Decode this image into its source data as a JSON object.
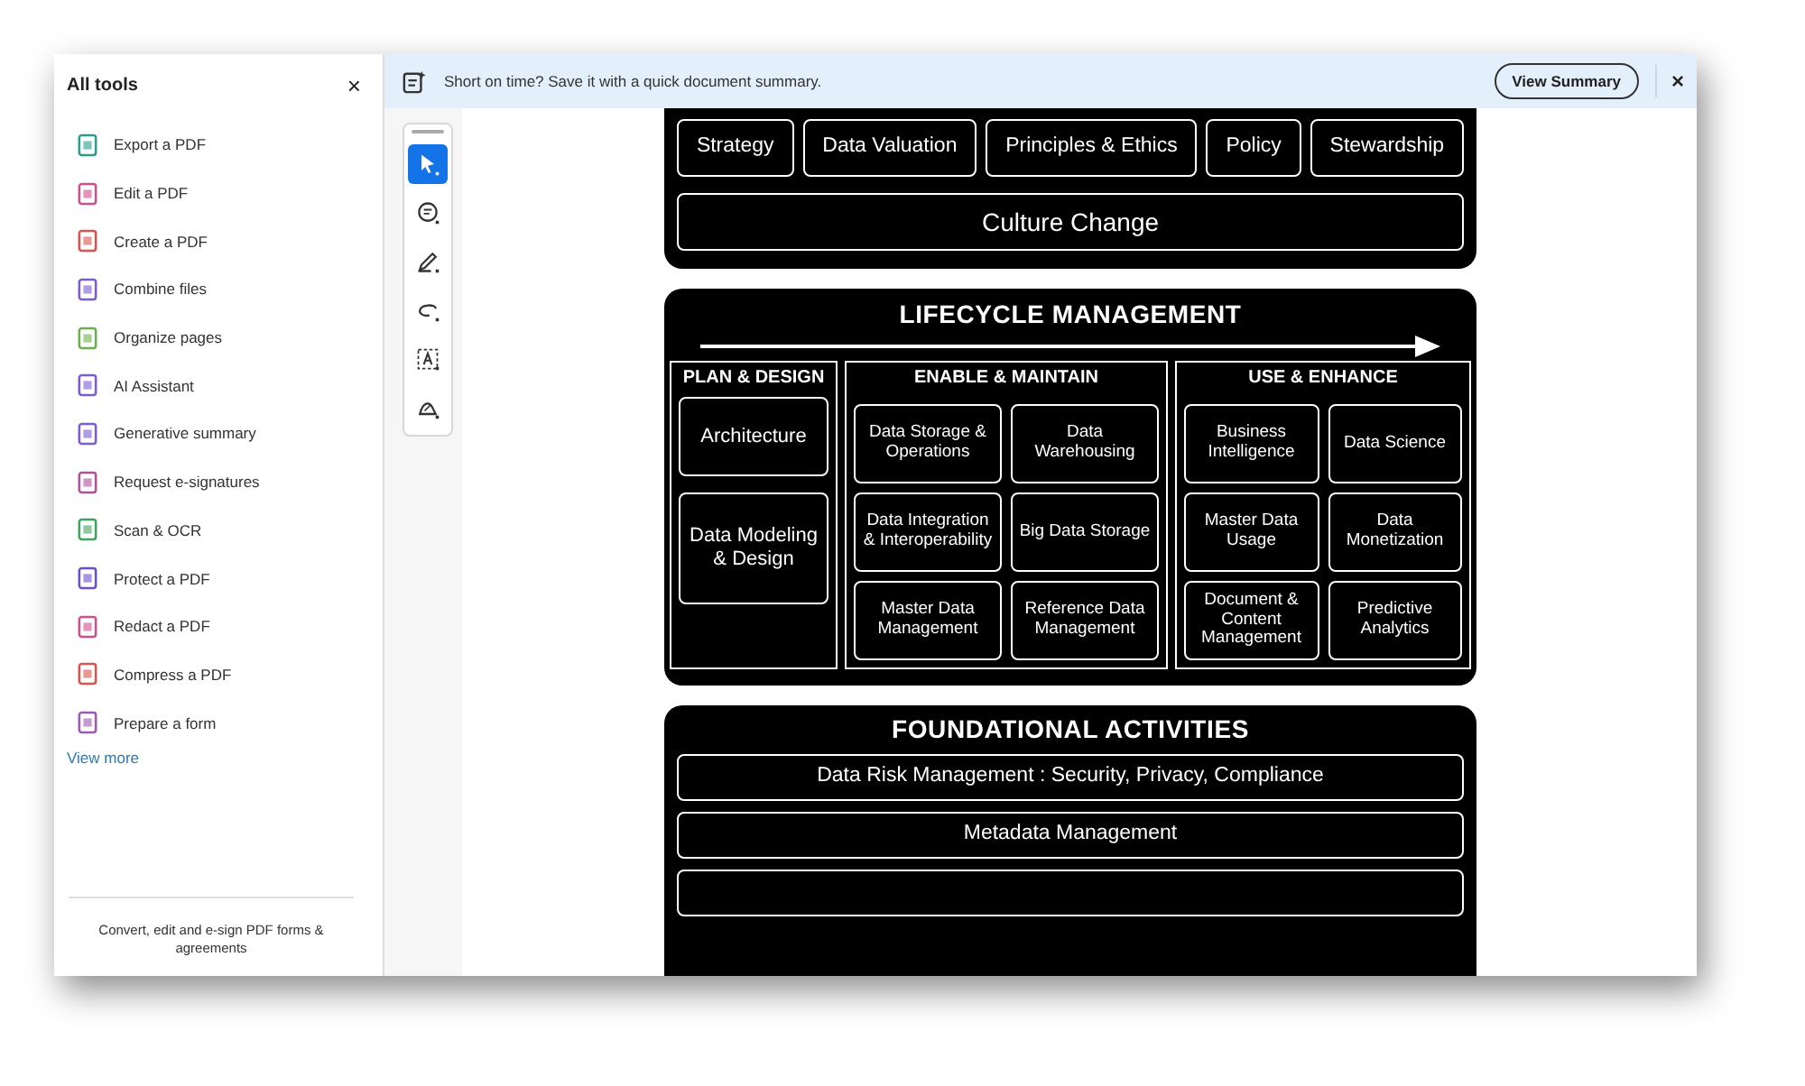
{
  "sidebar": {
    "title": "All tools",
    "close": "×",
    "items": [
      {
        "label": "Export a PDF"
      },
      {
        "label": "Edit a PDF"
      },
      {
        "label": "Create a PDF"
      },
      {
        "label": "Combine files"
      },
      {
        "label": "Organize pages"
      },
      {
        "label": "AI Assistant"
      },
      {
        "label": "Generative summary"
      },
      {
        "label": "Request e-signatures"
      },
      {
        "label": "Scan & OCR"
      },
      {
        "label": "Protect a PDF"
      },
      {
        "label": "Redact a PDF"
      },
      {
        "label": "Compress a PDF"
      },
      {
        "label": "Prepare a form"
      }
    ],
    "view_more": "View more",
    "footer": "Convert, edit and e-sign PDF forms & agreements"
  },
  "banner": {
    "text": "Short on time? Save it with a quick document summary.",
    "button": "View Summary",
    "close": "×"
  },
  "toolbar": {
    "tools": [
      {
        "kind": "select",
        "selected": true
      },
      {
        "kind": "comment",
        "selected": false
      },
      {
        "kind": "pen",
        "selected": false
      },
      {
        "kind": "lasso",
        "selected": false
      },
      {
        "kind": "textbox",
        "selected": false
      },
      {
        "kind": "sign",
        "selected": false
      }
    ]
  },
  "document": {
    "top_panel": {
      "items": [
        "Strategy",
        "Data Valuation",
        "Principles & Ethics",
        "Policy",
        "Stewardship"
      ],
      "wide_item": "Culture Change"
    },
    "lifecycle": {
      "title": "LIFECYCLE MANAGEMENT",
      "columns": [
        {
          "title": "PLAN & DESIGN",
          "items": [
            "Architecture",
            "Data Modeling & Design"
          ]
        },
        {
          "title": "ENABLE & MAINTAIN",
          "items": [
            "Data Storage & Operations",
            "Data Warehousing",
            "Data Integration & Interoperability",
            "Big Data Storage",
            "Master Data Management",
            "Reference Data Management"
          ]
        },
        {
          "title": "USE & ENHANCE",
          "items": [
            "Business Intelligence",
            "Data Science",
            "Master Data Usage",
            "Data Monetization",
            "Document & Content Management",
            "Predictive Analytics"
          ]
        }
      ]
    },
    "foundational": {
      "title": "FOUNDATIONAL ACTIVITIES",
      "items": [
        "Data Risk Management : Security, Privacy, Compliance",
        "Metadata Management"
      ]
    }
  }
}
